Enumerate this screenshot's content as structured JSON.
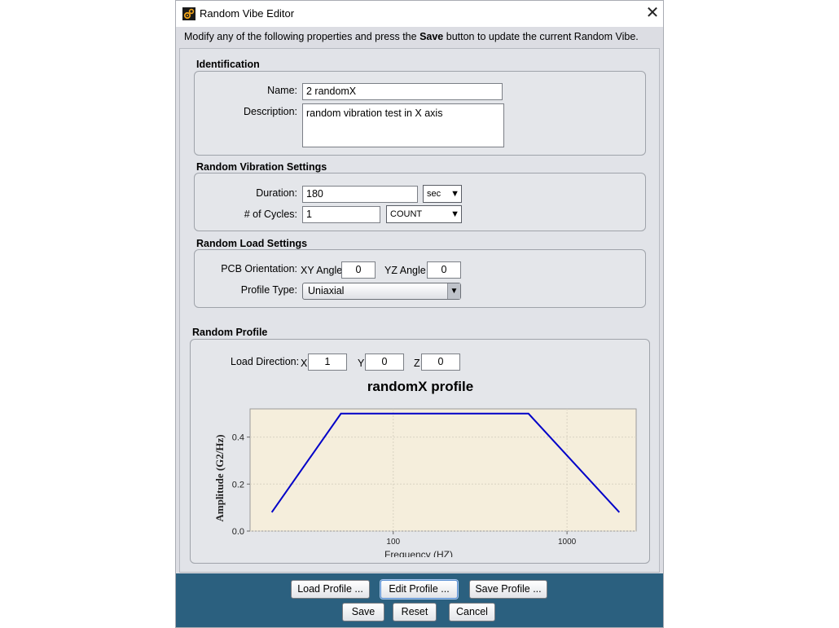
{
  "window": {
    "title": "Random Vibe Editor",
    "close_glyph": "✕",
    "instruction_prefix": "Modify any of the following properties and press the ",
    "instruction_bold": "Save",
    "instruction_suffix": " button to update the current Random Vibe."
  },
  "identification": {
    "title": "Identification",
    "name_label": "Name:",
    "name_value": "2 randomX",
    "description_label": "Description:",
    "description_value": "random vibration test in X axis"
  },
  "vibration_settings": {
    "title": "Random Vibration Settings",
    "duration_label": "Duration:",
    "duration_value": "180",
    "duration_unit": "sec",
    "cycles_label": "# of Cycles:",
    "cycles_value": "1",
    "cycles_unit": "COUNT",
    "arrow_glyph": "▼"
  },
  "load_settings": {
    "title": "Random Load Settings",
    "pcb_label": "PCB Orientation:",
    "xy_label": "XY Angle",
    "xy_value": "0",
    "yz_label": "YZ Angle",
    "yz_value": "0",
    "profile_type_label": "Profile Type:",
    "profile_type_value": "Uniaxial"
  },
  "random_profile": {
    "title": "Random Profile",
    "load_direction_label": "Load Direction:",
    "x_label": "X",
    "x_value": "1",
    "y_label": "Y",
    "y_value": "0",
    "z_label": "Z",
    "z_value": "0"
  },
  "chart_data": {
    "type": "line",
    "title": "randomX profile",
    "xlabel": "Frequency (HZ)",
    "ylabel": "Amplitude (G2/Hz)",
    "x_scale": "log",
    "xlim": [
      15,
      2500
    ],
    "ylim": [
      0,
      0.52
    ],
    "x_ticks": [
      100,
      1000
    ],
    "x_tick_labels": [
      "100",
      "1000"
    ],
    "y_ticks": [
      0,
      0.2,
      0.4
    ],
    "y_tick_labels": [
      "0.0",
      "0.2",
      "0.4"
    ],
    "grid": true,
    "line_color": "#0000c8",
    "plot_bg": "#f5eedc",
    "series": [
      {
        "x": [
          20,
          50,
          600,
          2000
        ],
        "y": [
          0.08,
          0.5,
          0.5,
          0.08
        ]
      }
    ]
  },
  "buttons": {
    "load_profile": "Load Profile ...",
    "edit_profile": "Edit Profile ...",
    "save_profile": "Save Profile ...",
    "save": "Save",
    "reset": "Reset",
    "cancel": "Cancel"
  },
  "colors": {
    "button_bar": "#2b607f",
    "dialog_bg": "#dcdde3"
  }
}
